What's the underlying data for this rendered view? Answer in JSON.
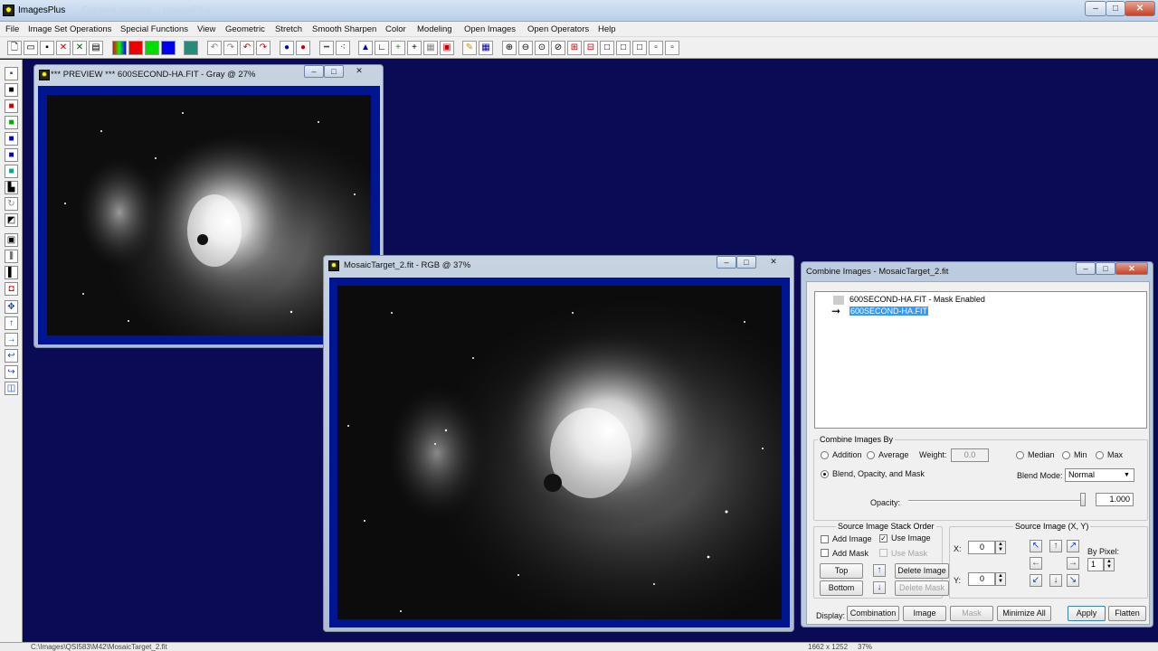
{
  "app": {
    "title": "ImagesPlus",
    "ghost_title": "... Cardinal Imaging ... ImagesPlus"
  },
  "menu": [
    "File",
    "Image Set Operations",
    "Special Functions",
    "View",
    "Geometric",
    "Stretch",
    "Smooth Sharpen",
    "Color",
    "Modeling",
    "Open Images",
    "Open Operators",
    "Help"
  ],
  "preview_window": {
    "title": "*** PREVIEW *** 600SECOND-HA.FIT - Gray @ 27%"
  },
  "mosaic_window": {
    "title": "MosaicTarget_2.fit - RGB @ 37%"
  },
  "dialog": {
    "title": "Combine Images - MosaicTarget_2.fit",
    "tree": {
      "item1": "600SECOND-HA.FIT - Mask Enabled",
      "item2": "600SECOND-HA.FIT"
    },
    "combine_by": {
      "group_label": "Combine Images By",
      "addition": "Addition",
      "average": "Average",
      "weight_label": "Weight:",
      "weight_value": "0.0",
      "median": "Median",
      "min": "Min",
      "max": "Max",
      "blend": "Blend, Opacity, and Mask",
      "blend_mode_label": "Blend Mode:",
      "blend_mode_value": "Normal",
      "opacity_label": "Opacity:",
      "opacity_value": "1.000",
      "opacity_fraction": 1.0
    },
    "stack_order": {
      "group_label": "Source Image Stack Order",
      "add_image": "Add Image",
      "use_image": "Use Image",
      "add_mask": "Add Mask",
      "use_mask": "Use Mask",
      "top": "Top",
      "bottom": "Bottom",
      "delete_image": "Delete Image",
      "delete_mask": "Delete Mask"
    },
    "source_xy": {
      "group_label": "Source Image (X, Y)",
      "x_label": "X:",
      "x_value": "0",
      "y_label": "Y:",
      "y_value": "0",
      "by_pixel_label": "By Pixel:",
      "by_pixel_value": "1"
    },
    "display": {
      "label": "Display:",
      "combination": "Combination",
      "image": "Image",
      "mask": "Mask",
      "minimize_all": "Minimize All",
      "apply": "Apply",
      "flatten": "Flatten"
    }
  },
  "status": {
    "path": "C:\\Images\\QSI583\\M42\\MosaicTarget_2.fit",
    "dims": "1662 x 1252",
    "zoom": "37%"
  }
}
